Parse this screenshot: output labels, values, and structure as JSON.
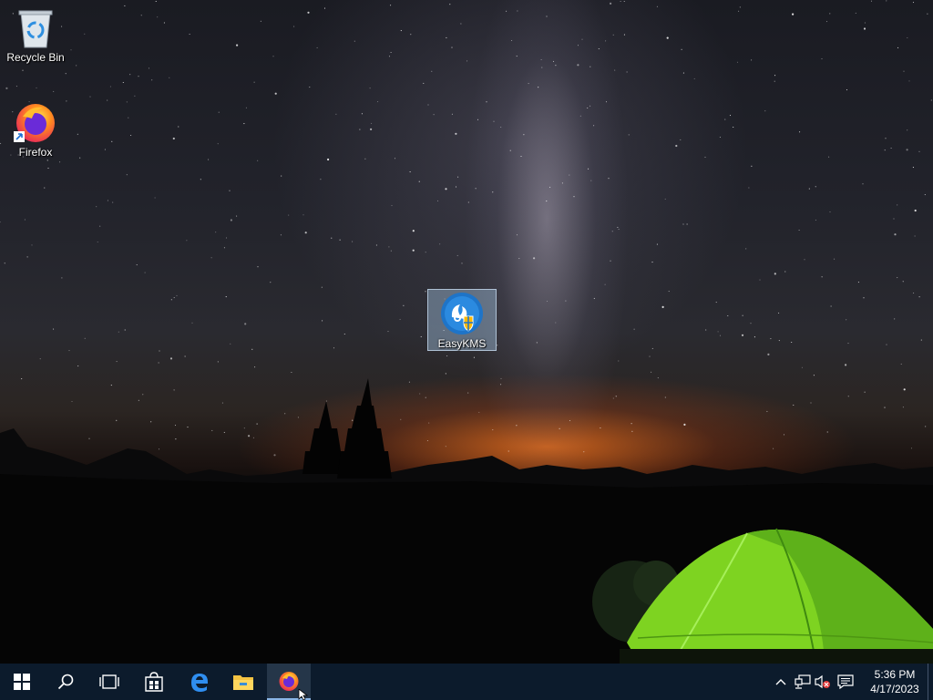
{
  "desktop": {
    "icons": [
      {
        "label": "Recycle Bin",
        "icon": "recycle-bin-icon"
      },
      {
        "label": "Firefox",
        "icon": "firefox-icon"
      },
      {
        "label": "EasyKMS",
        "icon": "easykms-icon"
      }
    ]
  },
  "taskbar": {
    "buttons": [
      {
        "icon": "windows-start-icon"
      },
      {
        "icon": "search-icon"
      },
      {
        "icon": "task-view-icon"
      },
      {
        "icon": "store-icon"
      },
      {
        "icon": "edge-icon"
      },
      {
        "icon": "file-explorer-icon"
      },
      {
        "icon": "firefox-icon",
        "active": true
      }
    ],
    "tray": {
      "icons": [
        "chevron-up-icon",
        "network-icon",
        "volume-muted-icon",
        "action-center-icon"
      ],
      "time": "5:36 PM",
      "date": "4/17/2023"
    }
  },
  "colors": {
    "taskbar": "#0c1b2c",
    "tent": "#7ed321",
    "horizon": "#e6781e"
  }
}
